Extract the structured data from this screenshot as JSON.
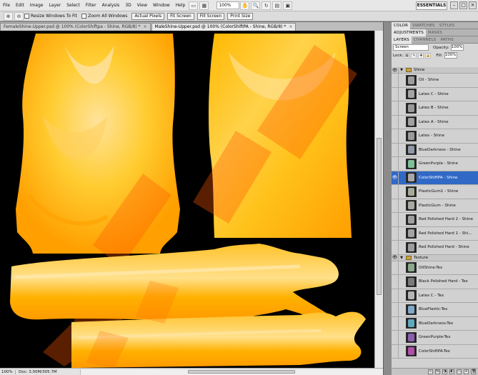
{
  "menus": [
    "File",
    "Edit",
    "Image",
    "Layer",
    "Select",
    "Filter",
    "Analysis",
    "3D",
    "View",
    "Window",
    "Help"
  ],
  "zoom_level": "100%",
  "workspace": "ESSENTIALS",
  "options": {
    "resize_windows": "Resize Windows To Fit",
    "zoom_all_windows": "Zoom All Windows",
    "actual_pixels": "Actual Pixels",
    "fit_screen": "Fit Screen",
    "fill_screen": "Fill Screen",
    "print_size": "Print Size"
  },
  "doc_tabs": [
    {
      "label": "FemaleShine-Upper.psd @ 100% (ColorShiftpa - Shine, RGB/8) *",
      "active": false
    },
    {
      "label": "MaleShine-Upper.psd @ 100% (ColorShiftPA - Shine, RGB/8) *",
      "active": true
    }
  ],
  "status": {
    "zoom": "100%",
    "doc": "Doc: 3.00M/305.7M"
  },
  "panels": {
    "row1": [
      "COLOR",
      "SWATCHES",
      "STYLES"
    ],
    "row2": [
      "ADJUSTMENTS",
      "MASKS"
    ],
    "row3": [
      "LAYERS",
      "CHANNELS",
      "PATHS"
    ],
    "blend_mode": "Screen",
    "opacity_label": "Opacity:",
    "opacity": "100%",
    "lock_label": "Lock:",
    "fill_label": "Fill:",
    "fill": "100%"
  },
  "layers": [
    {
      "type": "group",
      "name": "Shine"
    },
    {
      "type": "layer",
      "name": "Oil - Shine",
      "thumb": "#9c9c9c"
    },
    {
      "type": "layer",
      "name": "Latex C - Shine",
      "thumb": "#a4a4a4"
    },
    {
      "type": "layer",
      "name": "Latex B - Shine",
      "thumb": "#999999"
    },
    {
      "type": "layer",
      "name": "Latex A - Shine",
      "thumb": "#a0a0a0"
    },
    {
      "type": "layer",
      "name": "Latex - Shine",
      "thumb": "#9a9a9a"
    },
    {
      "type": "layer",
      "name": "BlueDarkness - Shine",
      "thumb": "#8f98a6"
    },
    {
      "type": "layer",
      "name": "GreenPurple - Shine",
      "thumb": "#7fbf9a"
    },
    {
      "type": "layer",
      "name": "ColorShiftPA - Shine",
      "thumb": "#a8a8a8",
      "selected": true
    },
    {
      "type": "layer",
      "name": "PlasticGum1 - Shine",
      "thumb": "#a5ab95"
    },
    {
      "type": "layer",
      "name": "PlasticGum - Shine",
      "thumb": "#a9a9a0"
    },
    {
      "type": "layer",
      "name": "Red Polished Hard 2 - Shine",
      "thumb": "#9f9f9f"
    },
    {
      "type": "layer",
      "name": "Red Polished Hard 1 - Shi...",
      "thumb": "#a3a3a3"
    },
    {
      "type": "layer",
      "name": "Red Polished Hard - Shine",
      "thumb": "#9d9d9d"
    },
    {
      "type": "group",
      "name": "Texture"
    },
    {
      "type": "layer",
      "name": "OilShine-Tex",
      "thumb": "#8da88a"
    },
    {
      "type": "layer",
      "name": "Black Polished Hard - Tex",
      "thumb": "#7a7a7a"
    },
    {
      "type": "layer",
      "name": "Latex C - Tex",
      "thumb": "#b5b5b5"
    },
    {
      "type": "layer",
      "name": "BluePlastic-Tex",
      "thumb": "#7fa7c8"
    },
    {
      "type": "layer",
      "name": "BlueDarkness-Tex",
      "thumb": "#5fa9c0"
    },
    {
      "type": "layer",
      "name": "GreenPurple-Tex",
      "thumb": "#8c5fb0"
    },
    {
      "type": "layer",
      "name": "ColorShiftPA-Tex",
      "thumb": "#b04fa8"
    }
  ]
}
